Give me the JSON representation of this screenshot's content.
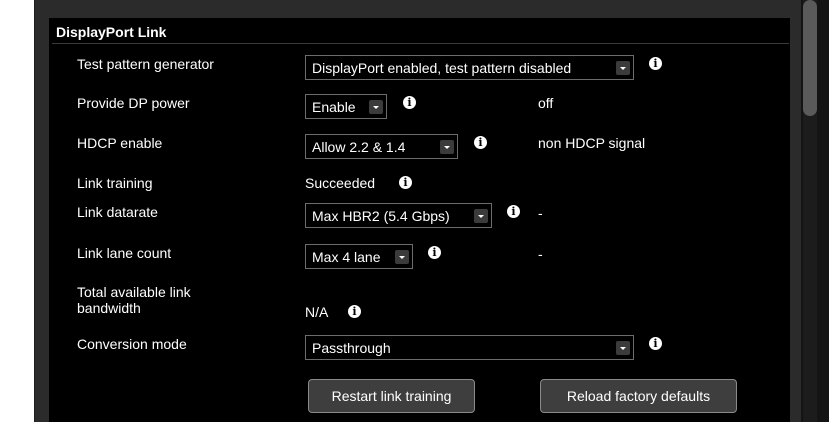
{
  "section": {
    "title": "DisplayPort Link"
  },
  "rows": {
    "test_pattern": {
      "label": "Test pattern generator",
      "value": "DisplayPort enabled, test pattern disabled"
    },
    "dp_power": {
      "label": "Provide DP power",
      "value": "Enable",
      "status": "off"
    },
    "hdcp": {
      "label": "HDCP enable",
      "value": "Allow 2.2 & 1.4",
      "status": "non HDCP signal"
    },
    "link_training": {
      "label": "Link training",
      "value": "Succeeded"
    },
    "link_datarate": {
      "label": "Link datarate",
      "value": "Max HBR2 (5.4 Gbps)",
      "status": "-"
    },
    "lane_count": {
      "label": "Link lane count",
      "value": "Max 4 lane",
      "status": "-"
    },
    "bandwidth": {
      "label_line1": "Total available link",
      "label_line2": "bandwidth",
      "value": "N/A"
    },
    "conversion": {
      "label": "Conversion mode",
      "value": "Passthrough"
    }
  },
  "buttons": {
    "restart": "Restart link training",
    "reload": "Reload factory defaults"
  },
  "icons": {
    "info": "i"
  },
  "colors": {
    "background": "#000000",
    "text": "#ffffff",
    "button_bg": "#3e3e3e"
  }
}
